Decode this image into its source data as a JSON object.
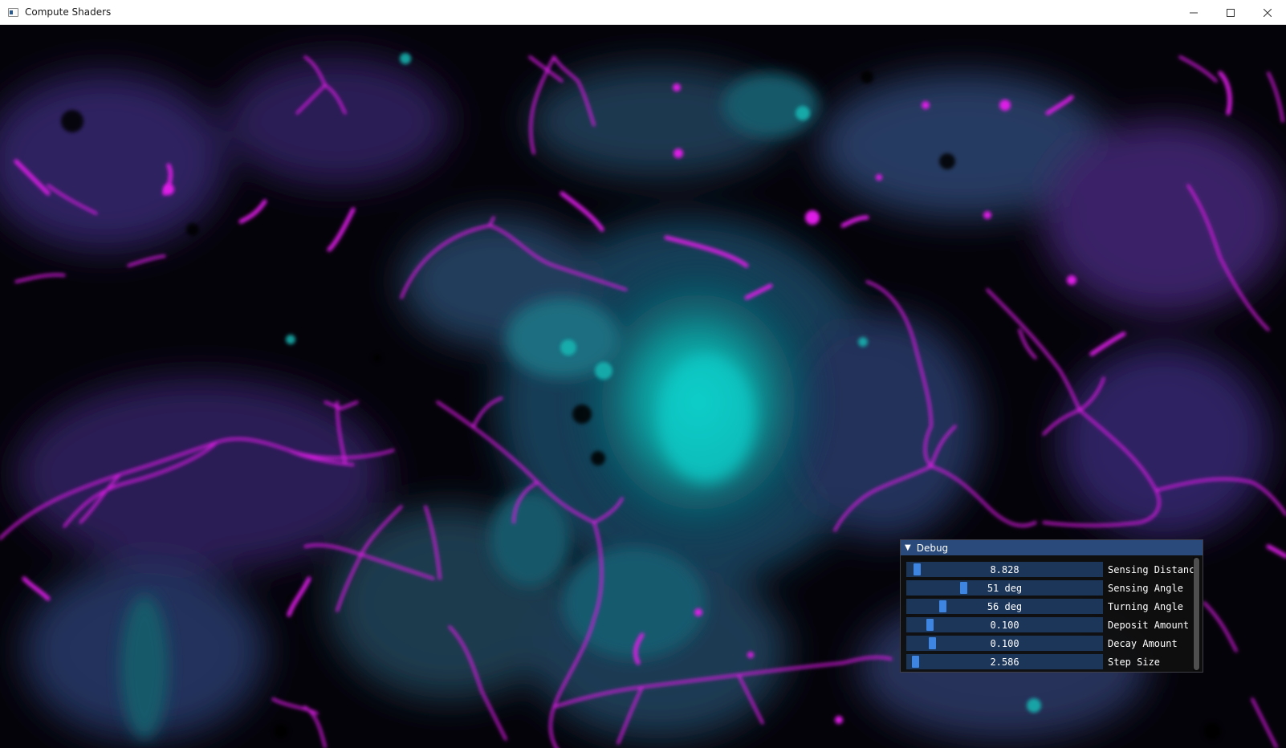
{
  "window": {
    "title": "Compute Shaders"
  },
  "caption_buttons": {
    "minimize_icon": "minimize-icon",
    "maximize_icon": "maximize-icon",
    "close_icon": "close-icon"
  },
  "colors": {
    "magenta": "#e01ce8",
    "teal": "#12d0cc",
    "indigo": "#3a2a78",
    "slate_blue": "#3a5f8a",
    "imgui_title": "#294a7a",
    "imgui_frame": "#1c365a",
    "imgui_grab": "#3d85e0"
  },
  "debug": {
    "title": "Debug",
    "sliders": [
      {
        "label": "Sensing Distanc",
        "value": "8.828",
        "fill": 0.03
      },
      {
        "label": "Sensing Angle",
        "value": "51 deg",
        "fill": 0.28
      },
      {
        "label": "Turning Angle",
        "value": "56 deg",
        "fill": 0.17
      },
      {
        "label": "Deposit Amount",
        "value": "0.100",
        "fill": 0.1
      },
      {
        "label": "Decay Amount",
        "value": "0.100",
        "fill": 0.11
      },
      {
        "label": "Step Size",
        "value": "2.586",
        "fill": 0.02
      }
    ]
  }
}
